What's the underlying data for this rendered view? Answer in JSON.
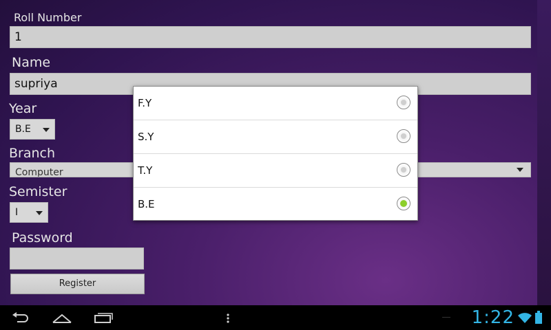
{
  "form": {
    "roll_label": "Roll Number",
    "roll_value": "1",
    "name_label": "Name",
    "name_value": "supriya",
    "year_label": "Year",
    "year_value": "B.E",
    "branch_label": "Branch",
    "branch_value": "Computer",
    "semister_label": "Semister",
    "semister_value": "I",
    "password_label": "Password",
    "password_value": "",
    "register_label": "Register"
  },
  "dialog": {
    "options": [
      {
        "label": "F.Y",
        "checked": false
      },
      {
        "label": "S.Y",
        "checked": false
      },
      {
        "label": "T.Y",
        "checked": false
      },
      {
        "label": "B.E",
        "checked": true
      }
    ]
  },
  "status": {
    "clock": "1:22"
  },
  "colors": {
    "accent_clock": "#33b5e5",
    "radio_checked": "#8ccf2a"
  },
  "icons": [
    "back-icon",
    "home-icon",
    "recent-apps-icon",
    "menu-icon",
    "wifi-icon",
    "battery-icon"
  ]
}
